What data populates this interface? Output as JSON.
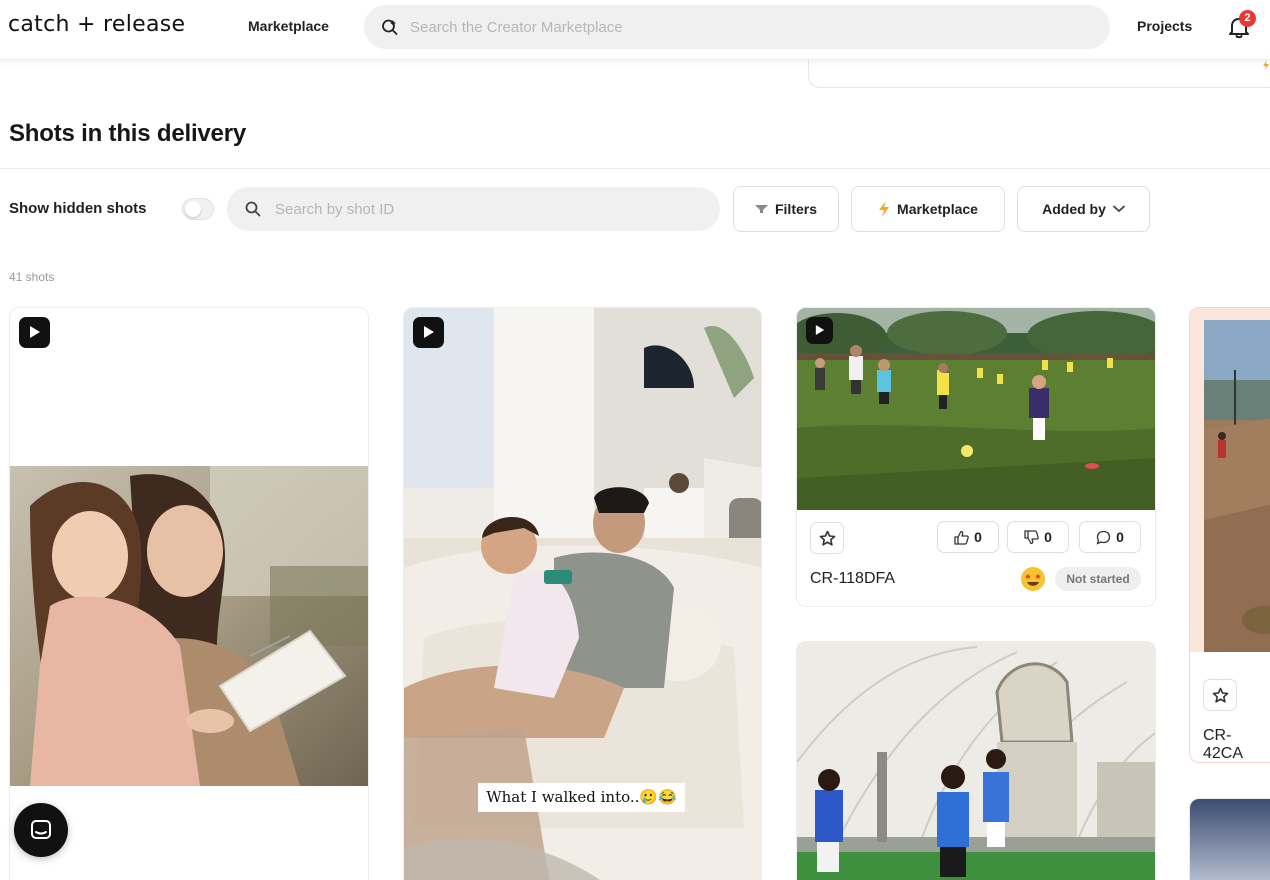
{
  "app": {
    "brand": "catch + release"
  },
  "topbar": {
    "nav_marketplace": "Marketplace",
    "search_placeholder": "Search the Creator Marketplace",
    "nav_projects": "Projects",
    "notifications_count": "2"
  },
  "section": {
    "title": "Shots in this delivery"
  },
  "toolbar": {
    "show_hidden_label": "Show hidden shots",
    "show_hidden_on": false,
    "search_placeholder": "Search by shot ID",
    "filters_label": "Filters",
    "marketplace_label": "Marketplace",
    "added_by_label": "Added by"
  },
  "shots_count": "41 shots",
  "cards": [
    {
      "type": "video",
      "image": "mother and daughter reading a book"
    },
    {
      "type": "video",
      "image": "father holding baby on couch",
      "caption": "What I walked into..🥲😂"
    },
    {
      "type": "video",
      "image": "kids soccer practice on grass field",
      "likes": "0",
      "dislikes": "0",
      "comments": "0",
      "shot_id": "CR-118DFA",
      "status": "Not started",
      "status_emoji": "star-struck"
    },
    {
      "type": "image",
      "image": "soccer players in indoor dome"
    },
    {
      "type": "image",
      "image": "person on dirt field at sunset",
      "shot_id": "CR-42CA"
    },
    {
      "type": "image",
      "image": "sky gradient"
    }
  ],
  "icons": {
    "search": "search-icon",
    "bell": "bell-icon",
    "play": "play-icon",
    "star": "star-icon",
    "thumbs_up": "thumbs-up-icon",
    "thumbs_down": "thumbs-down-icon",
    "comment": "comment-icon",
    "filter": "filter-icon",
    "lightning": "lightning-icon",
    "chevron": "chevron-down-icon",
    "chat": "chat-icon"
  },
  "colors": {
    "accent_orange": "#f5a623",
    "badge_red": "#e53935",
    "bubble": "#111111"
  }
}
